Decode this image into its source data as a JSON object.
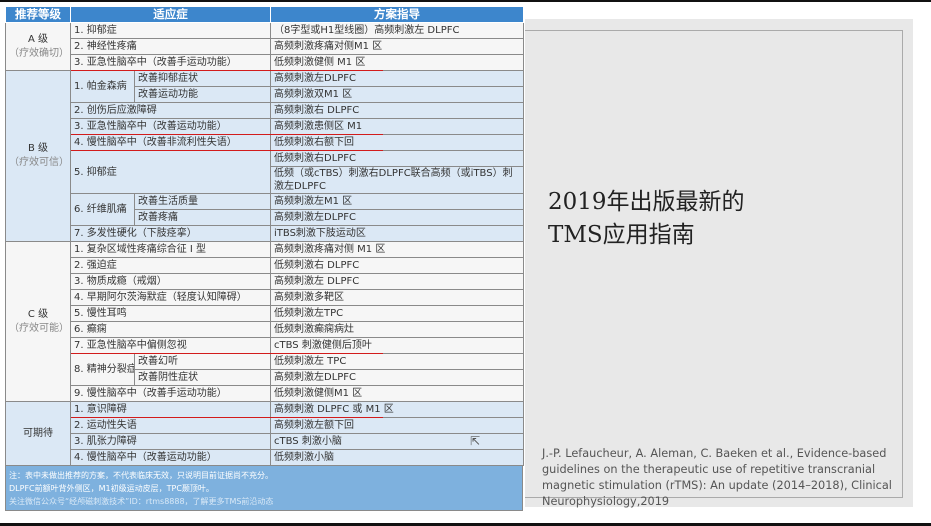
{
  "table": {
    "headers": [
      "推荐等级",
      "适应症",
      "方案指导"
    ],
    "groups": [
      {
        "grade": "A 级",
        "note": "（疗效确切）",
        "cls": "gA",
        "rows": [
          {
            "ind": "1. 抑郁症",
            "plan": "（8字型或H1型线圈）高频刺激左 DLPFC"
          },
          {
            "ind": "2. 神经性疼痛",
            "plan": "高频刺激疼痛对侧M1 区"
          },
          {
            "ind": "3. 亚急性脑卒中（改善手运动功能）",
            "plan": "低频刺激健侧 M1 区",
            "underline": true
          }
        ]
      },
      {
        "grade": "B 级",
        "note": "（疗效可信）",
        "cls": "gB",
        "rows": [
          {
            "ind": "1. 帕金森病",
            "subs": [
              {
                "sub": "改善抑郁症状",
                "plan": "高频刺激左DLPFC"
              },
              {
                "sub": "改善运动功能",
                "plan": "高频刺激双M1 区"
              }
            ]
          },
          {
            "ind": "2. 创伤后应激障碍",
            "plan": "高频刺激右 DLPFC"
          },
          {
            "ind": "3. 亚急性脑卒中（改善运动功能）",
            "plan": "高频刺激患侧区 M1",
            "underline": true
          },
          {
            "ind": "4. 慢性脑卒中（改善非流利性失语）",
            "plan": "低频刺激右额下回",
            "underline": true
          },
          {
            "ind": "5. 抑郁症",
            "plans": [
              "低频刺激右DLPFC",
              "低频（或cTBS）刺激右DLPFC联合高频（或iTBS）刺激左DLPFC"
            ]
          },
          {
            "ind": "6. 纤维肌痛",
            "subs": [
              {
                "sub": "改善生活质量",
                "plan": "高频刺激左M1 区"
              },
              {
                "sub": "改善疼痛",
                "plan": "高频刺激左DLPFC"
              }
            ]
          },
          {
            "ind": "7. 多发性硬化（下肢痉挛）",
            "plan": "iTBS刺激下肢运动区"
          }
        ]
      },
      {
        "grade": "C 级",
        "note": "（疗效可能）",
        "cls": "gC",
        "rows": [
          {
            "ind": "1. 复杂区域性疼痛综合征 I 型",
            "plan": "高频刺激疼痛对侧 M1 区"
          },
          {
            "ind": "2. 强迫症",
            "plan": "低频刺激右 DLPFC"
          },
          {
            "ind": "3. 物质成瘾（戒烟）",
            "plan": "高频刺激左 DLPFC"
          },
          {
            "ind": "4. 早期阿尔茨海默症（轻度认知障碍）",
            "plan": "高频刺激多靶区"
          },
          {
            "ind": "5. 慢性耳鸣",
            "plan": "低频刺激左TPC"
          },
          {
            "ind": "6. 癫痫",
            "plan": "低频刺激癫痫病灶"
          },
          {
            "ind": "7. 亚急性脑卒中偏侧忽视",
            "plan": "cTBS 刺激健侧后顶叶",
            "underline": true
          },
          {
            "ind": "8. 精神分裂症",
            "subs": [
              {
                "sub": "改善幻听",
                "plan": "低频刺激左 TPC"
              },
              {
                "sub": "改善阴性症状",
                "plan": "高频刺激左DLPFC"
              }
            ]
          },
          {
            "ind": "9. 慢性脑卒中（改善手运动功能）",
            "plan": "低频刺激健侧M1 区"
          }
        ]
      },
      {
        "grade": "可期待",
        "note": "",
        "cls": "gD",
        "rows": [
          {
            "ind": "1. 意识障碍",
            "plan": "高频刺激 DLPFC 或 M1 区",
            "underline": true
          },
          {
            "ind": "2. 运动性失语",
            "plan": "高频刺激左额下回"
          },
          {
            "ind": "3. 肌张力障碍",
            "plan": "cTBS 刺激小脑"
          },
          {
            "ind": "4. 慢性脑卒中（改善运动功能）",
            "plan": "低频刺激小脑"
          }
        ]
      }
    ],
    "notes": [
      "注：表中未做出推荐的方案，不代表临床无效，只说明目前证据尚不充分。",
      "DLPFC前额叶背外侧区，M1初级运动皮层，TPC颞顶叶。",
      "关注微信公众号“经颅磁刺激技术”ID：rtms8888，了解更多TMS前沿动态"
    ],
    "underline_color": "#d21b1b"
  },
  "panel": {
    "title_line1": "2019年出版最新的",
    "title_line2": "TMS应用指南",
    "citation": "J.-P. Lefaucheur, A. Aleman, C. Baeken et al., Evidence-based guidelines on the therapeutic use of repetitive transcranial magnetic stimulation (rTMS): An update (2014–2018), Clinical Neurophysiology,2019"
  }
}
